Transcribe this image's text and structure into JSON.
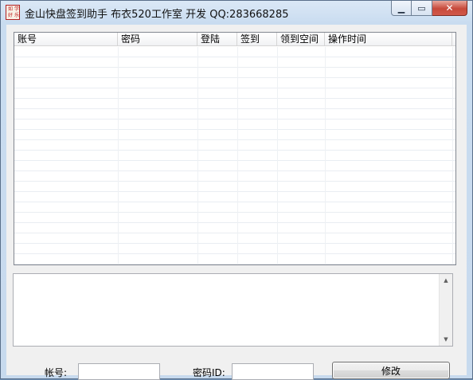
{
  "window": {
    "title": "金山快盘签到助手   布衣520工作室 开发 QQ:283668285",
    "icon_glyphs": [
      "如",
      "学",
      "好",
      "乐"
    ],
    "controls": {
      "minimize": "▁",
      "maximize": "▭",
      "close": "✕"
    }
  },
  "listview": {
    "columns": [
      "账号",
      "密码",
      "登陆",
      "签到",
      "领到空间",
      "操作时间"
    ],
    "rows": []
  },
  "log": {
    "value": ""
  },
  "form": {
    "account_label": "帐号:",
    "account_value": "",
    "password_label": "密码ID:",
    "password_value": "",
    "modify_button": "修改"
  },
  "colors": {
    "titlebar": "#dbe8f6",
    "close_button": "#c7493a",
    "dialog_face": "#f0f0f0",
    "grid_line": "#e9edf2"
  },
  "icons": {
    "app": "app-logo-icon",
    "minimize": "minimize-icon",
    "maximize": "maximize-icon",
    "close": "close-icon",
    "scroll_up": "arrow-up-icon",
    "scroll_down": "arrow-down-icon"
  }
}
